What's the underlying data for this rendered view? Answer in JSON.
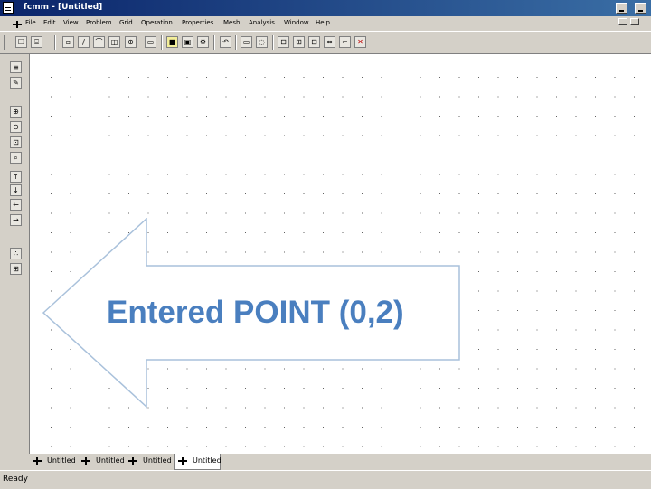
{
  "window": {
    "title": "fcmm - [Untitled]"
  },
  "menu": {
    "items": [
      "File",
      "Edit",
      "View",
      "Problem",
      "Grid",
      "Operation",
      "Properties",
      "Mesh",
      "Analysis",
      "Window",
      "Help"
    ]
  },
  "toolbar": {
    "buttons": [
      {
        "name": "new-file-icon",
        "glyph": "☐"
      },
      {
        "name": "open-file-icon",
        "glyph": "⌸"
      },
      {
        "name": "point-mode-icon",
        "glyph": "▫"
      },
      {
        "name": "segment-mode-icon",
        "glyph": "∕"
      },
      {
        "name": "arc-mode-icon",
        "glyph": "⌒"
      },
      {
        "name": "block-label-icon",
        "glyph": "◫"
      },
      {
        "name": "group-mode-icon",
        "glyph": "⊕"
      },
      {
        "name": "rectangle-icon",
        "glyph": "▭"
      },
      {
        "name": "material-icon",
        "glyph": "■"
      },
      {
        "name": "boundary-icon",
        "glyph": "▣"
      },
      {
        "name": "circuit-icon",
        "glyph": "⚙"
      },
      {
        "name": "undo-icon",
        "glyph": "↶"
      },
      {
        "name": "box-select-icon",
        "glyph": "▭"
      },
      {
        "name": "circle-select-icon",
        "glyph": "◌"
      },
      {
        "name": "move-icon",
        "glyph": "⊟"
      },
      {
        "name": "copy-icon",
        "glyph": "⊞"
      },
      {
        "name": "scale-icon",
        "glyph": "⊡"
      },
      {
        "name": "mirror-icon",
        "glyph": "⇔"
      },
      {
        "name": "fillet-icon",
        "glyph": "⌐"
      },
      {
        "name": "delete-icon",
        "glyph": "✕"
      }
    ]
  },
  "side_toolbar": {
    "buttons": [
      {
        "name": "properties-icon",
        "glyph": "≡"
      },
      {
        "name": "edit-icon",
        "glyph": "✎"
      },
      {
        "name": "zoom-in-icon",
        "glyph": "⊕"
      },
      {
        "name": "zoom-out-icon",
        "glyph": "⊖"
      },
      {
        "name": "zoom-natural-icon",
        "glyph": "⊡"
      },
      {
        "name": "zoom-window-icon",
        "glyph": "⌕"
      },
      {
        "name": "pan-up-icon",
        "glyph": "↑"
      },
      {
        "name": "pan-down-icon",
        "glyph": "↓"
      },
      {
        "name": "pan-left-icon",
        "glyph": "←"
      },
      {
        "name": "pan-right-icon",
        "glyph": "→"
      },
      {
        "name": "snap-grid-icon",
        "glyph": "∴"
      },
      {
        "name": "show-grid-icon",
        "glyph": "⊞"
      }
    ]
  },
  "annotation": {
    "text": "Entered POINT (0,2)"
  },
  "tabs": [
    "Untitled",
    "Untitled",
    "Untitled",
    "Untitled"
  ],
  "status": {
    "text": "Ready"
  },
  "colors": {
    "accent_text": "#4a7fbf",
    "title_bar": "#0a246a"
  }
}
